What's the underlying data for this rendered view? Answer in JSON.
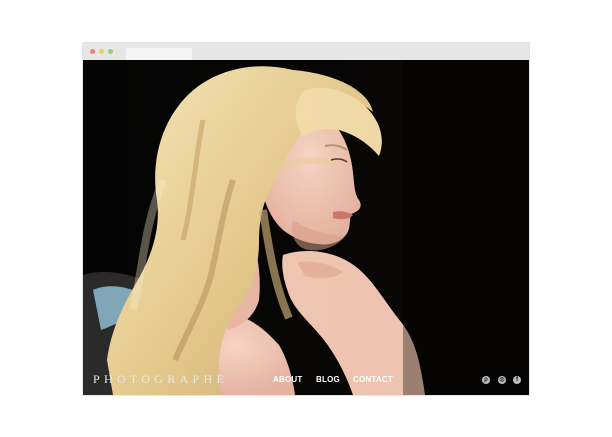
{
  "brand": {
    "logo_text": "PHOTOGRAPHE"
  },
  "nav": {
    "about": "ABOUT",
    "blog": "BLOG",
    "contact": "CONTACT"
  },
  "social": [
    {
      "name": "pinterest-icon",
      "glyph": "p"
    },
    {
      "name": "instagram-icon",
      "glyph": "◎"
    },
    {
      "name": "facebook-icon",
      "glyph": "f"
    }
  ],
  "colors": {
    "background": "#000000",
    "nav_text": "#ffffff",
    "window_chrome": "#e6e6e6"
  }
}
